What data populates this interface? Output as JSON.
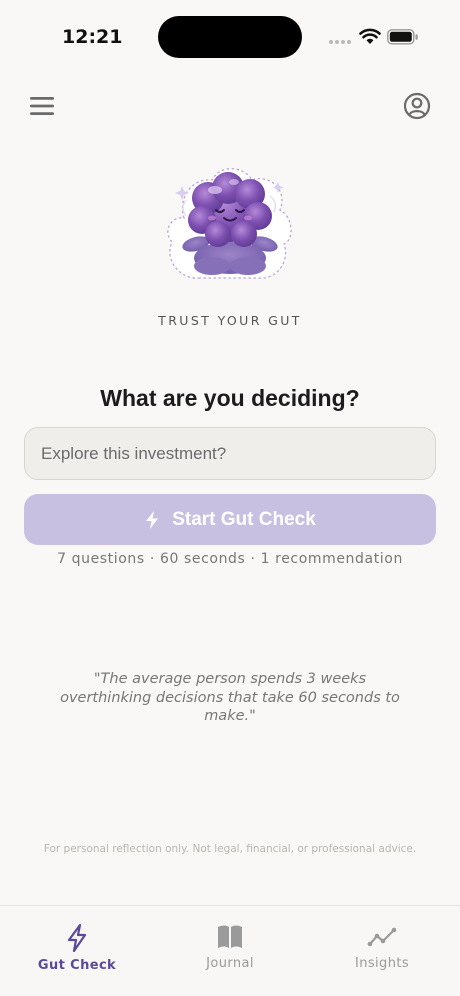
{
  "status_bar": {
    "time": "12:21"
  },
  "tagline": "TRUST YOUR GUT",
  "heading": "What are you deciding?",
  "decision_input": {
    "placeholder": "Explore this investment?",
    "value": ""
  },
  "start_button": {
    "label": "Start Gut Check"
  },
  "meta_line": "7 questions · 60 seconds · 1 recommendation",
  "quote": "\"The average person spends 3 weeks overthinking decisions that take 60 seconds to make.\"",
  "disclaimer": "For personal reflection only. Not legal, financial, or professional advice.",
  "tabs": [
    {
      "label": "Gut Check",
      "icon": "bolt-icon",
      "active": true
    },
    {
      "label": "Journal",
      "icon": "book-icon",
      "active": false
    },
    {
      "label": "Insights",
      "icon": "trend-icon",
      "active": false
    }
  ],
  "colors": {
    "accent": "#5c4a98",
    "button_disabled": "#c8c0e0",
    "mascot": "#7d4fb0"
  }
}
